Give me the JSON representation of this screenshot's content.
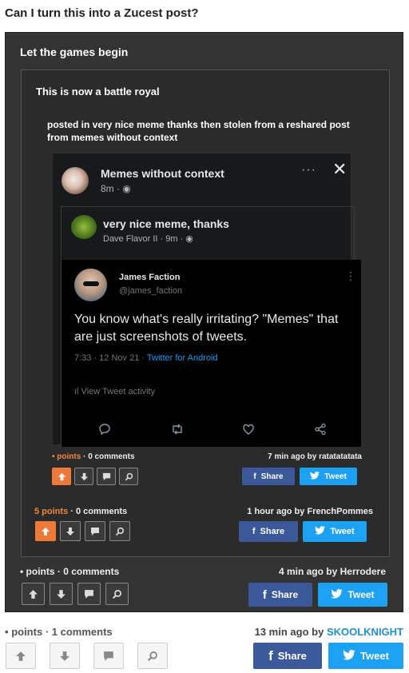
{
  "page": {
    "title": "Can I turn this into a Zucest post?"
  },
  "level1": {
    "title": "Let the games begin",
    "meta": {
      "bullet": "•",
      "points": "points",
      "sep": "·",
      "comments": "0 comments"
    },
    "byline": {
      "time": "4 min ago by",
      "user": "Herrodere"
    }
  },
  "level2": {
    "title": "This is now a battle royal",
    "posted_text": "posted in very nice meme thanks then stolen from a reshared post from memes without context",
    "meta": {
      "points": "5 points",
      "sep": "·",
      "comments": "0 comments"
    },
    "byline": {
      "time": "1 hour ago by",
      "user": "FrenchPommes"
    }
  },
  "level3": {
    "meta": {
      "bullet": "•",
      "points": "points",
      "sep": "·",
      "comments": "0 comments"
    },
    "byline": {
      "time": "7 min ago by",
      "user": "ratatatatata"
    }
  },
  "fb": {
    "page_name": "Memes without context",
    "page_meta": "8m · ◉",
    "dots": "···",
    "close": "✕",
    "shared_name": "very nice meme, thanks",
    "shared_meta": "Dave Flavor II · 9m · ◉"
  },
  "tweet": {
    "name": "James Faction",
    "handle": "@james_faction",
    "more": "⋮",
    "text": "You know what's really irritating? \"Memes\" that are just screenshots of tweets.",
    "time": "7:33 · 12 Nov 21 · ",
    "client": "Twitter for Android",
    "activity": "ıl View Tweet activity"
  },
  "outer": {
    "meta": {
      "bullet": "•",
      "points": "points",
      "sep": "·",
      "comments": "1 comments"
    },
    "byline": {
      "time": "13 min ago by",
      "user": "SKOOLKNIGHT"
    }
  },
  "buttons": {
    "share": "Share",
    "tweet": "Tweet",
    "fb_icon": "f"
  },
  "colors": {
    "upvote_active": "#ee7a3a",
    "facebook": "#3b5998",
    "twitter": "#1da1f2",
    "username": "#3ca8e8"
  }
}
